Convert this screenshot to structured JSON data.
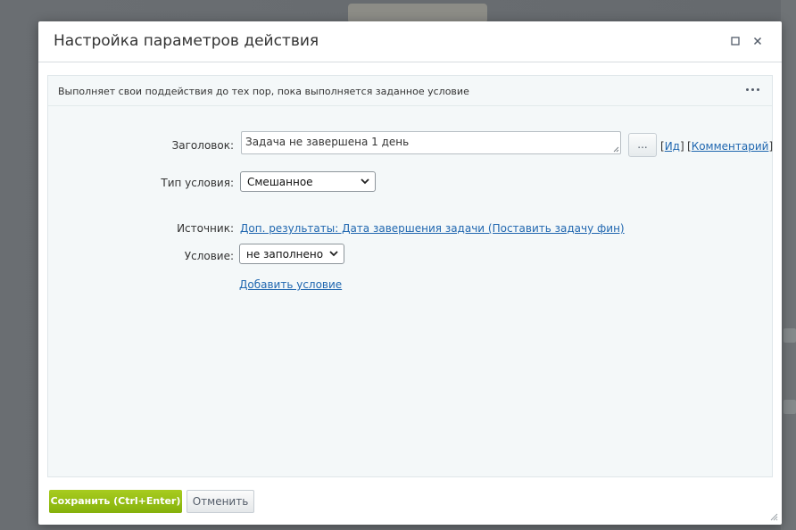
{
  "dialog": {
    "title": "Настройка параметров действия",
    "header_icons": [
      "maximize-icon",
      "close-icon"
    ]
  },
  "panel": {
    "description": "Выполняет свои поддействия до тех пор, пока выполняется заданное условие",
    "more_icon": "more-dots-icon"
  },
  "form": {
    "title_label": "Заголовок:",
    "title_value": "Задача не завершена 1 день",
    "dots_button": "...",
    "id_link": "Ид",
    "comment_link": "Комментарий",
    "condition_type_label": "Тип условия:",
    "condition_type_value": "Смешанное",
    "source_label": "Источник:",
    "source_value": "Доп. результаты: Дата завершения задачи (Поставить задачу фин)",
    "condition_label": "Условие:",
    "condition_value": "не заполнено",
    "add_condition_link": "Добавить условие"
  },
  "footer": {
    "save_label": "Сохранить (Ctrl+Enter)",
    "cancel_label": "Отменить"
  },
  "colors": {
    "accent_green": "#93bd13",
    "link_blue": "#2067b0",
    "panel_bg": "#f4f8f9"
  }
}
